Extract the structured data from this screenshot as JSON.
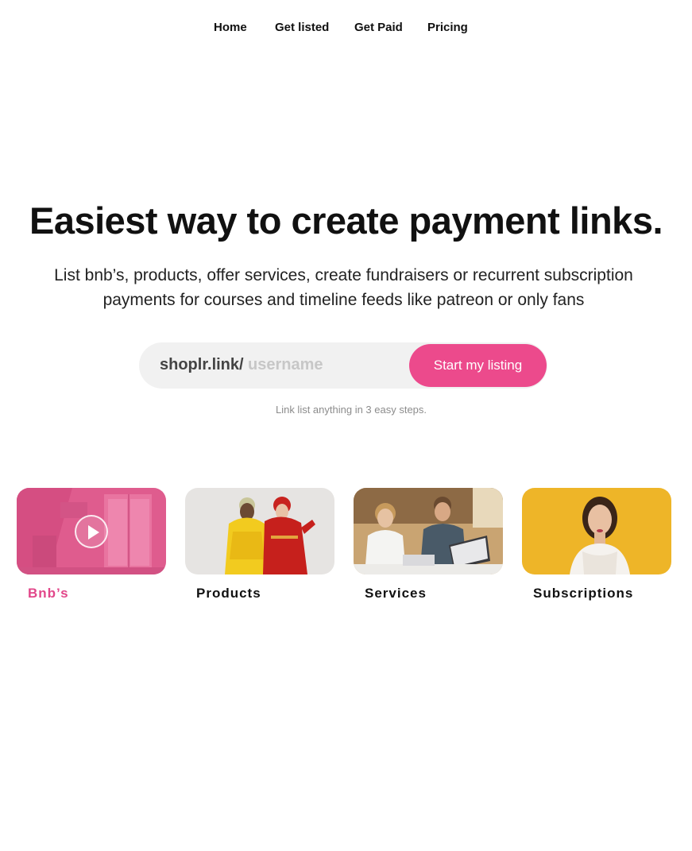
{
  "nav": {
    "items": [
      {
        "label": "Home"
      },
      {
        "label": "Get listed"
      },
      {
        "label": "Get Paid"
      },
      {
        "label": "Pricing"
      }
    ]
  },
  "hero": {
    "title": "Easiest way to create payment links.",
    "subtitle": "List bnb’s, products, offer services, create fundraisers or recurrent subscription payments for courses and timeline feeds like patreon or only fans"
  },
  "signup": {
    "prefix": "shoplr.link/",
    "placeholder": "username",
    "button_label": "Start my listing",
    "helper_text": "Link list anything in 3 easy steps."
  },
  "categories": [
    {
      "label": "Bnb’s",
      "active": true,
      "icon": "play-icon"
    },
    {
      "label": "Products",
      "active": false
    },
    {
      "label": "Services",
      "active": false
    },
    {
      "label": "Subscriptions",
      "active": false
    }
  ],
  "colors": {
    "accent": "#ec4a8c",
    "active_label": "#e2478a",
    "input_bg": "#f1f1f1",
    "subscriptions_bg": "#f0b82a"
  }
}
